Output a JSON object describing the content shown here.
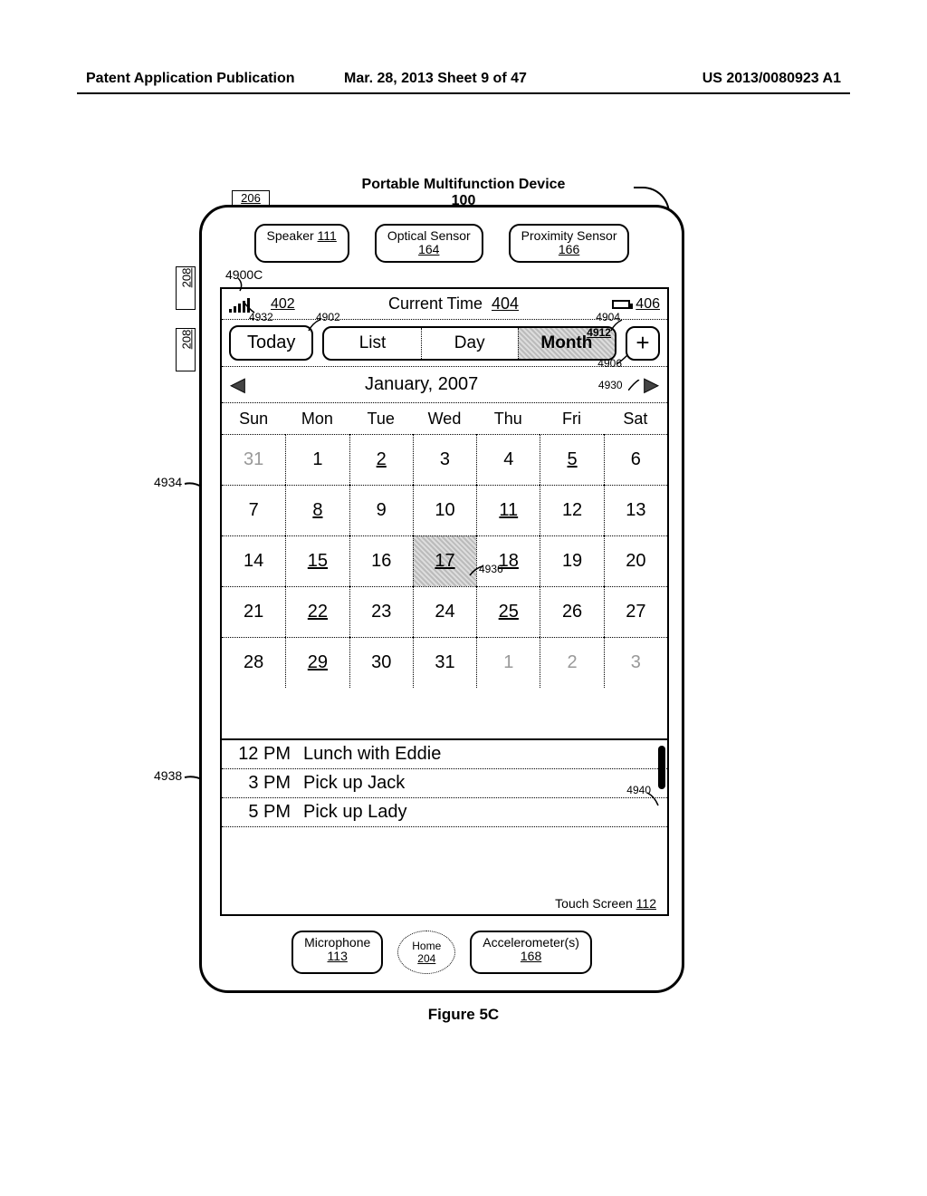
{
  "header": {
    "left": "Patent Application Publication",
    "center": "Mar. 28, 2013  Sheet 9 of 47",
    "right": "US 2013/0080923 A1"
  },
  "title": {
    "line1": "Portable Multifunction Device",
    "line2": "100"
  },
  "device": {
    "top_label_ref": "206",
    "side_refs": [
      "208",
      "208"
    ],
    "speaker": {
      "label": "Speaker",
      "ref": "111"
    },
    "optical": {
      "label": "Optical Sensor",
      "ref": "164"
    },
    "proximity": {
      "label": "Proximity Sensor",
      "ref": "166"
    },
    "microphone": {
      "label": "Microphone",
      "ref": "113"
    },
    "home": {
      "label": "Home",
      "ref": "204"
    },
    "accel": {
      "label": "Accelerometer(s)",
      "ref": "168"
    },
    "touchscreen": {
      "label": "Touch Screen",
      "ref": "112"
    }
  },
  "screen": {
    "ref_4900C": "4900C",
    "status": {
      "signal_ref": "402",
      "time_label": "Current Time",
      "time_ref": "404",
      "battery_ref": "406"
    },
    "toolbar": {
      "today": "Today",
      "seg": [
        "List",
        "Day",
        "Month"
      ],
      "selected_index": 2,
      "ref_4902": "4902",
      "ref_4904": "4904",
      "ref_4906": "4906",
      "ref_4912": "4912"
    },
    "month": {
      "title": "January, 2007",
      "ref_prev": "4932",
      "ref_next": "4930",
      "dow": [
        "Sun",
        "Mon",
        "Tue",
        "Wed",
        "Thu",
        "Fri",
        "Sat"
      ],
      "cells": [
        {
          "d": "31",
          "dim": true
        },
        {
          "d": "1"
        },
        {
          "d": "2",
          "u": true
        },
        {
          "d": "3"
        },
        {
          "d": "4"
        },
        {
          "d": "5",
          "u": true
        },
        {
          "d": "6"
        },
        {
          "d": "7"
        },
        {
          "d": "8",
          "u": true
        },
        {
          "d": "9"
        },
        {
          "d": "10"
        },
        {
          "d": "11",
          "u": true
        },
        {
          "d": "12"
        },
        {
          "d": "13"
        },
        {
          "d": "14"
        },
        {
          "d": "15",
          "u": true
        },
        {
          "d": "16"
        },
        {
          "d": "17",
          "u": true,
          "sel": true
        },
        {
          "d": "18",
          "u": true
        },
        {
          "d": "19"
        },
        {
          "d": "20"
        },
        {
          "d": "21"
        },
        {
          "d": "22",
          "u": true
        },
        {
          "d": "23"
        },
        {
          "d": "24"
        },
        {
          "d": "25",
          "u": true
        },
        {
          "d": "26"
        },
        {
          "d": "27"
        },
        {
          "d": "28"
        },
        {
          "d": "29",
          "u": true
        },
        {
          "d": "30"
        },
        {
          "d": "31"
        },
        {
          "d": "1",
          "dim": true
        },
        {
          "d": "2",
          "dim": true
        },
        {
          "d": "3",
          "dim": true
        }
      ],
      "ref_4934": "4934",
      "ref_4936": "4936",
      "ref_4938": "4938",
      "ref_4940": "4940"
    },
    "events": [
      {
        "time": "12 PM",
        "title": "Lunch with Eddie"
      },
      {
        "time": "3 PM",
        "title": "Pick up Jack"
      },
      {
        "time": "5 PM",
        "title": "Pick up Lady"
      }
    ]
  },
  "figure_label": "Figure 5C"
}
